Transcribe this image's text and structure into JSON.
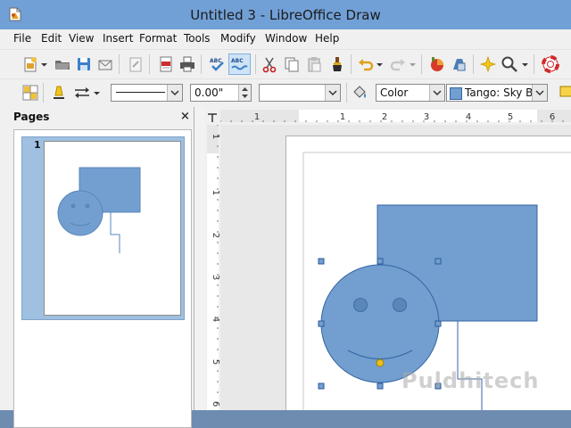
{
  "window": {
    "title": "Untitled 3 - LibreOffice Draw"
  },
  "menubar": {
    "items": [
      {
        "label": "File",
        "key": "F"
      },
      {
        "label": "Edit",
        "key": "E"
      },
      {
        "label": "View",
        "key": "V"
      },
      {
        "label": "Insert",
        "key": "I"
      },
      {
        "label": "Format",
        "key": "o"
      },
      {
        "label": "Tools",
        "key": "T"
      },
      {
        "label": "Modify",
        "key": "M"
      },
      {
        "label": "Window",
        "key": "W"
      },
      {
        "label": "Help",
        "key": "H"
      }
    ]
  },
  "toolbar2": {
    "line_width": "0.00\"",
    "area_style": "Color",
    "fill_color": "Tango: Sky Blu"
  },
  "pages_panel": {
    "title": "Pages",
    "close": "×",
    "page_number": "1"
  },
  "ruler": {
    "h_numbers": [
      "1",
      "1",
      "2",
      "3",
      "4",
      "5",
      "6"
    ],
    "v_numbers": [
      "1",
      "1",
      "2",
      "3",
      "4",
      "5",
      "6"
    ]
  },
  "watermark": "Puldhitech",
  "colors": {
    "titlebar": "#71a0d6",
    "shape_fill": "#729fcf",
    "shape_stroke": "#3465a4",
    "selection": "#9fc0e0"
  }
}
